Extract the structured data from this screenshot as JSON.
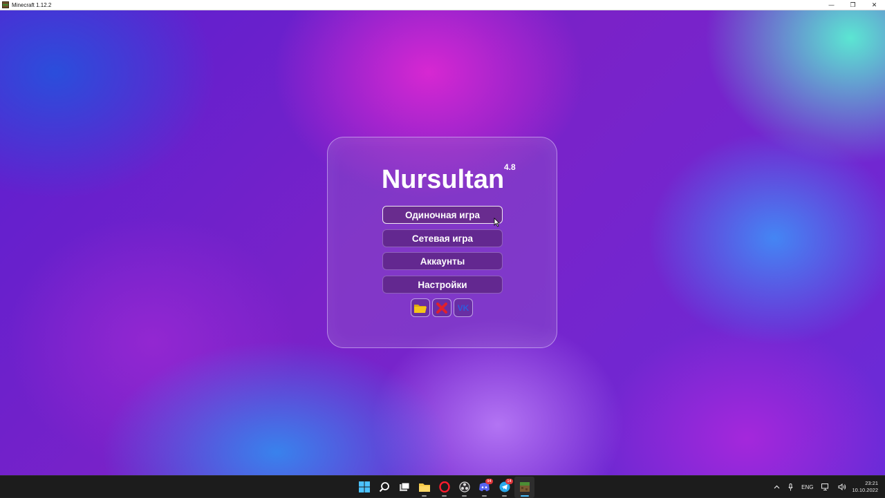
{
  "window": {
    "title": "Minecraft 1.12.2",
    "controls": {
      "minimize": "—",
      "restore": "❐",
      "close": "✕"
    }
  },
  "menu": {
    "logo": "Nursultan",
    "version": "4.8",
    "buttons": [
      {
        "label": "Одиночная игра",
        "state": "hovered"
      },
      {
        "label": "Сетевая игра"
      },
      {
        "label": "Аккаунты"
      },
      {
        "label": "Настройки"
      }
    ],
    "icon_buttons": [
      {
        "icon": "folder-icon"
      },
      {
        "icon": "close-x-icon"
      },
      {
        "icon": "vk-icon",
        "text": "VK"
      }
    ]
  },
  "taskbar": {
    "apps": [
      {
        "icon": "windows-start-icon"
      },
      {
        "icon": "search-icon"
      },
      {
        "icon": "task-view-icon"
      },
      {
        "icon": "file-explorer-icon"
      },
      {
        "icon": "opera-icon"
      },
      {
        "icon": "obs-icon"
      },
      {
        "icon": "discord-icon",
        "badge": "94"
      },
      {
        "icon": "telegram-icon",
        "badge": "14"
      },
      {
        "icon": "minecraft-icon",
        "active": true
      }
    ],
    "tray": {
      "language": "ENG",
      "time": "23:21",
      "date": "10.10.2022"
    }
  },
  "colors": {
    "panel_border": "#e6d2ff",
    "button_bg": "#501e6e",
    "vk_blue": "#2f5bdc",
    "close_red": "#e0202c",
    "folder_yellow": "#f5c518"
  }
}
